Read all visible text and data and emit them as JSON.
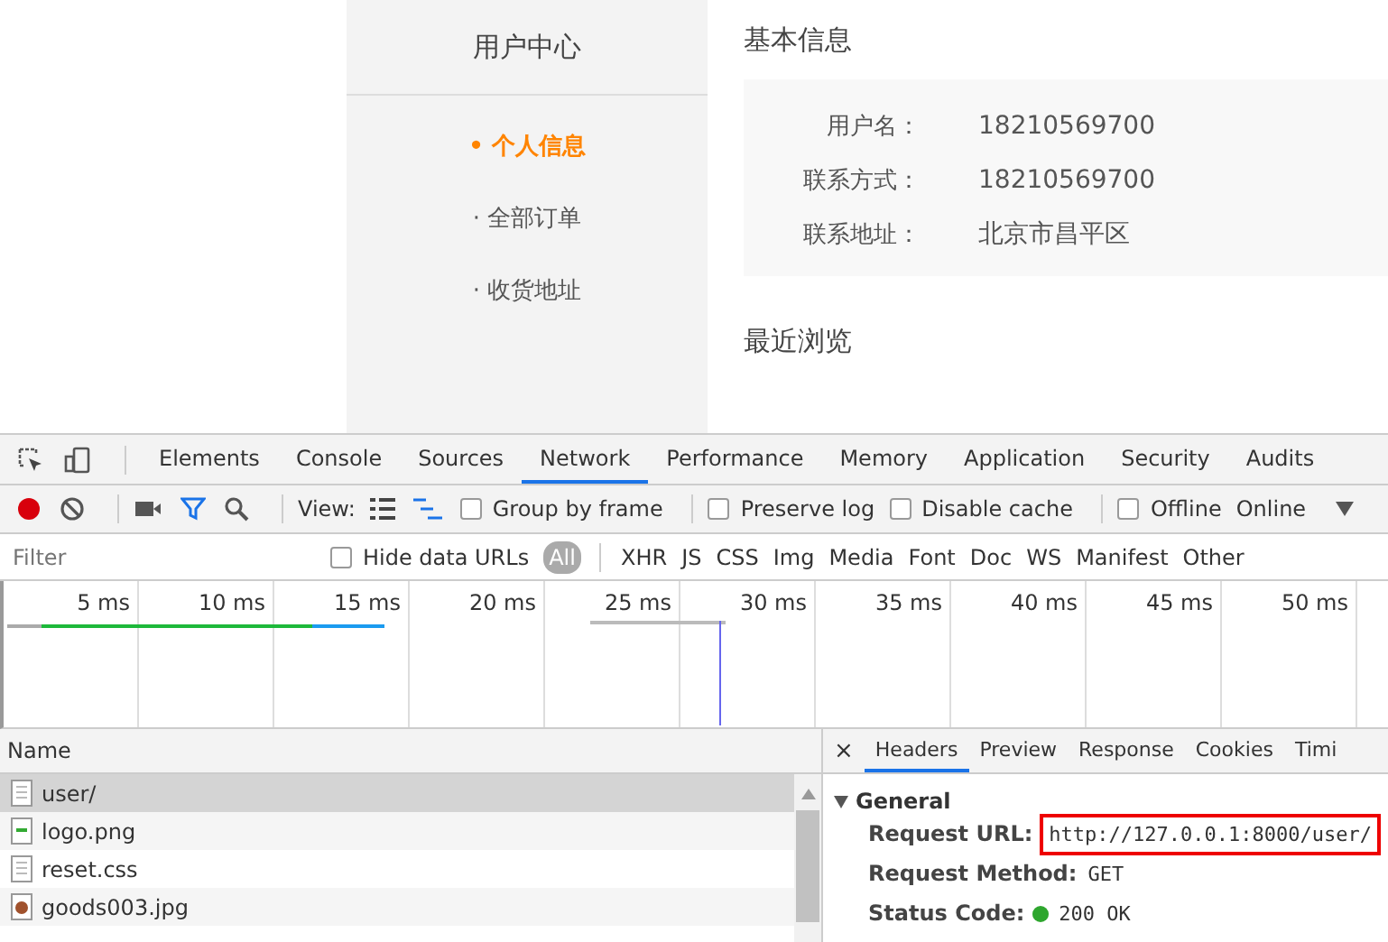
{
  "page": {
    "sidebar": {
      "title": "用户中心",
      "items": [
        {
          "label": "• 个人信息",
          "selected": true
        },
        {
          "label": "· 全部订单",
          "selected": false
        },
        {
          "label": "· 收货地址",
          "selected": false
        }
      ]
    },
    "basic_info": {
      "title": "基本信息",
      "fields": [
        {
          "label": "用户名：",
          "value": "18210569700"
        },
        {
          "label": "联系方式：",
          "value": "18210569700"
        },
        {
          "label": "联系地址：",
          "value": "北京市昌平区"
        }
      ]
    },
    "recent_title": "最近浏览"
  },
  "devtools": {
    "tabs": [
      {
        "label": "Elements",
        "selected": false
      },
      {
        "label": "Console",
        "selected": false
      },
      {
        "label": "Sources",
        "selected": false
      },
      {
        "label": "Network",
        "selected": true
      },
      {
        "label": "Performance",
        "selected": false
      },
      {
        "label": "Memory",
        "selected": false
      },
      {
        "label": "Application",
        "selected": false
      },
      {
        "label": "Security",
        "selected": false
      },
      {
        "label": "Audits",
        "selected": false
      }
    ],
    "toolbar": {
      "view_label": "View:",
      "options": [
        {
          "label": "Group by frame",
          "checked": false
        },
        {
          "label": "Preserve log",
          "checked": false
        },
        {
          "label": "Disable cache",
          "checked": false
        },
        {
          "label": "Offline",
          "checked": false
        }
      ],
      "throttle": "Online"
    },
    "filter": {
      "placeholder": "Filter",
      "hide_data_urls": {
        "label": "Hide data URLs",
        "checked": false
      },
      "types": [
        {
          "label": "All",
          "selected": true
        },
        {
          "label": "XHR",
          "selected": false
        },
        {
          "label": "JS",
          "selected": false
        },
        {
          "label": "CSS",
          "selected": false
        },
        {
          "label": "Img",
          "selected": false
        },
        {
          "label": "Media",
          "selected": false
        },
        {
          "label": "Font",
          "selected": false
        },
        {
          "label": "Doc",
          "selected": false
        },
        {
          "label": "WS",
          "selected": false
        },
        {
          "label": "Manifest",
          "selected": false
        },
        {
          "label": "Other",
          "selected": false
        }
      ]
    },
    "timeline_ticks": [
      "5 ms",
      "10 ms",
      "15 ms",
      "20 ms",
      "25 ms",
      "30 ms",
      "35 ms",
      "40 ms",
      "45 ms",
      "50 ms"
    ],
    "requests": {
      "column": "Name",
      "rows": [
        {
          "name": "user/",
          "kind": "document",
          "selected": true
        },
        {
          "name": "logo.png",
          "kind": "image",
          "selected": false
        },
        {
          "name": "reset.css",
          "kind": "document",
          "selected": false
        },
        {
          "name": "goods003.jpg",
          "kind": "photo",
          "selected": false
        }
      ]
    },
    "detail": {
      "close": "×",
      "tabs": [
        {
          "label": "Headers",
          "selected": true
        },
        {
          "label": "Preview",
          "selected": false
        },
        {
          "label": "Response",
          "selected": false
        },
        {
          "label": "Cookies",
          "selected": false
        },
        {
          "label": "Timi",
          "selected": false
        }
      ],
      "section": {
        "title": "General",
        "expanded": true,
        "rows": [
          {
            "label": "Request URL:",
            "value": "http://127.0.0.1:8000/user/",
            "highlighted": true,
            "status_dot": false
          },
          {
            "label": "Request Method:",
            "value": "GET",
            "highlighted": false,
            "status_dot": false
          },
          {
            "label": "Status Code:",
            "value": "200 OK",
            "highlighted": false,
            "status_dot": true
          }
        ]
      }
    }
  }
}
